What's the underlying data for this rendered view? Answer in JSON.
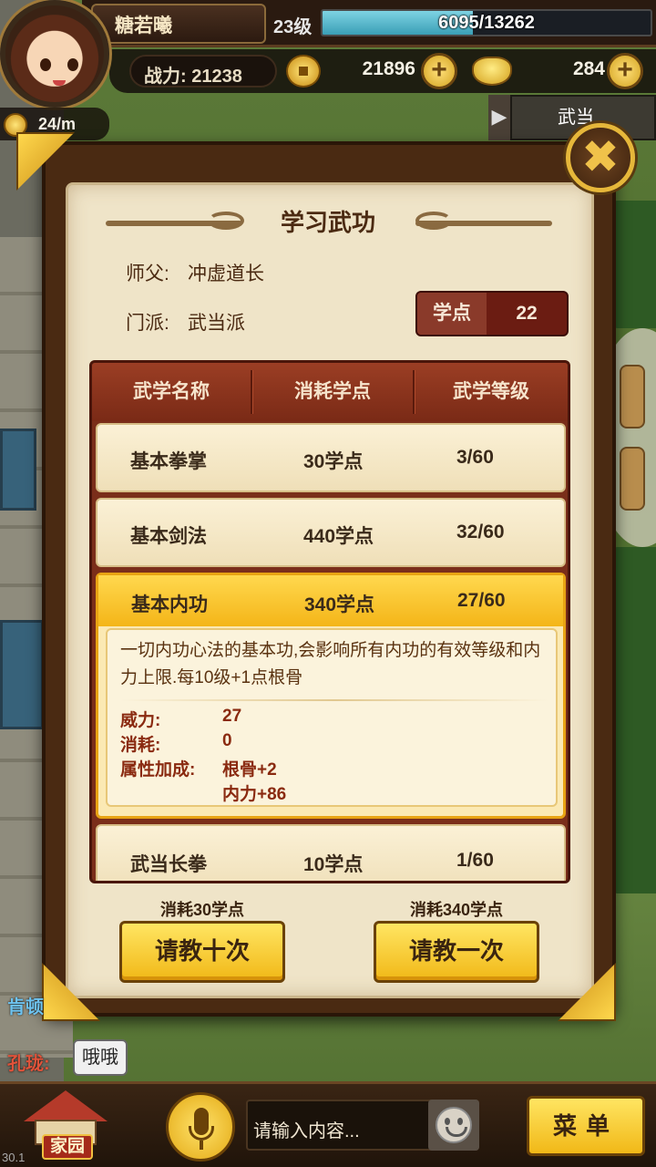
{
  "player": {
    "name": "糖若曦",
    "level": "23级",
    "exp_current": 6095,
    "exp_max": 13262,
    "exp_text": "6095/13262",
    "power": "战力: 21238",
    "coins": "21896",
    "ingots": "284",
    "income_rate": "24/m"
  },
  "scene": {
    "sign_label": "武当"
  },
  "dialog": {
    "title": "学习武功",
    "master_label": "师父:",
    "master_value": "冲虚道长",
    "sect_label": "门派:",
    "sect_value": "武当派",
    "points_label": "学点",
    "points_value": "22",
    "close_icon": "✖"
  },
  "table": {
    "headers": [
      "武学名称",
      "消耗学点",
      "武学等级"
    ],
    "rows": [
      {
        "name": "基本拳掌",
        "cost": "30学点",
        "level": "3/60"
      },
      {
        "name": "基本剑法",
        "cost": "440学点",
        "level": "32/60"
      },
      {
        "name": "基本内功",
        "cost": "340学点",
        "level": "27/60"
      },
      {
        "name": "武当长拳",
        "cost": "10学点",
        "level": "1/60"
      }
    ],
    "selected_index": 2,
    "detail": {
      "description": "一切内功心法的基本功,会影响所有内功的有效等级和内力上限.每10级+1点根骨",
      "power_label": "威力:",
      "power_value": "27",
      "cost_label": "消耗:",
      "cost_value": "0",
      "bonus_label": "属性加成:",
      "bonus_1": "根骨+2",
      "bonus_2": "内力+86"
    }
  },
  "actions": {
    "ten_cost": "消耗30学点",
    "ten_label": "请教十次",
    "one_cost": "消耗340学点",
    "one_label": "请教一次"
  },
  "chat": {
    "line1": "肯顿",
    "line2_name": "孔珑:",
    "line2_bubble": "哦哦",
    "placeholder": "请输入内容...",
    "home_label": "家园",
    "menu_label": "菜单",
    "fps": "30.1"
  },
  "colors": {
    "accent_gold": "#f1b817",
    "frame_brown": "#4a2a12",
    "header_red": "#7a2a16",
    "exp_cyan": "#3a9fb6"
  },
  "icons": [
    "avatar",
    "coin-icon",
    "ingot-icon",
    "plus-icon",
    "close-icon",
    "mic-icon",
    "smiley-icon",
    "home-icon"
  ]
}
